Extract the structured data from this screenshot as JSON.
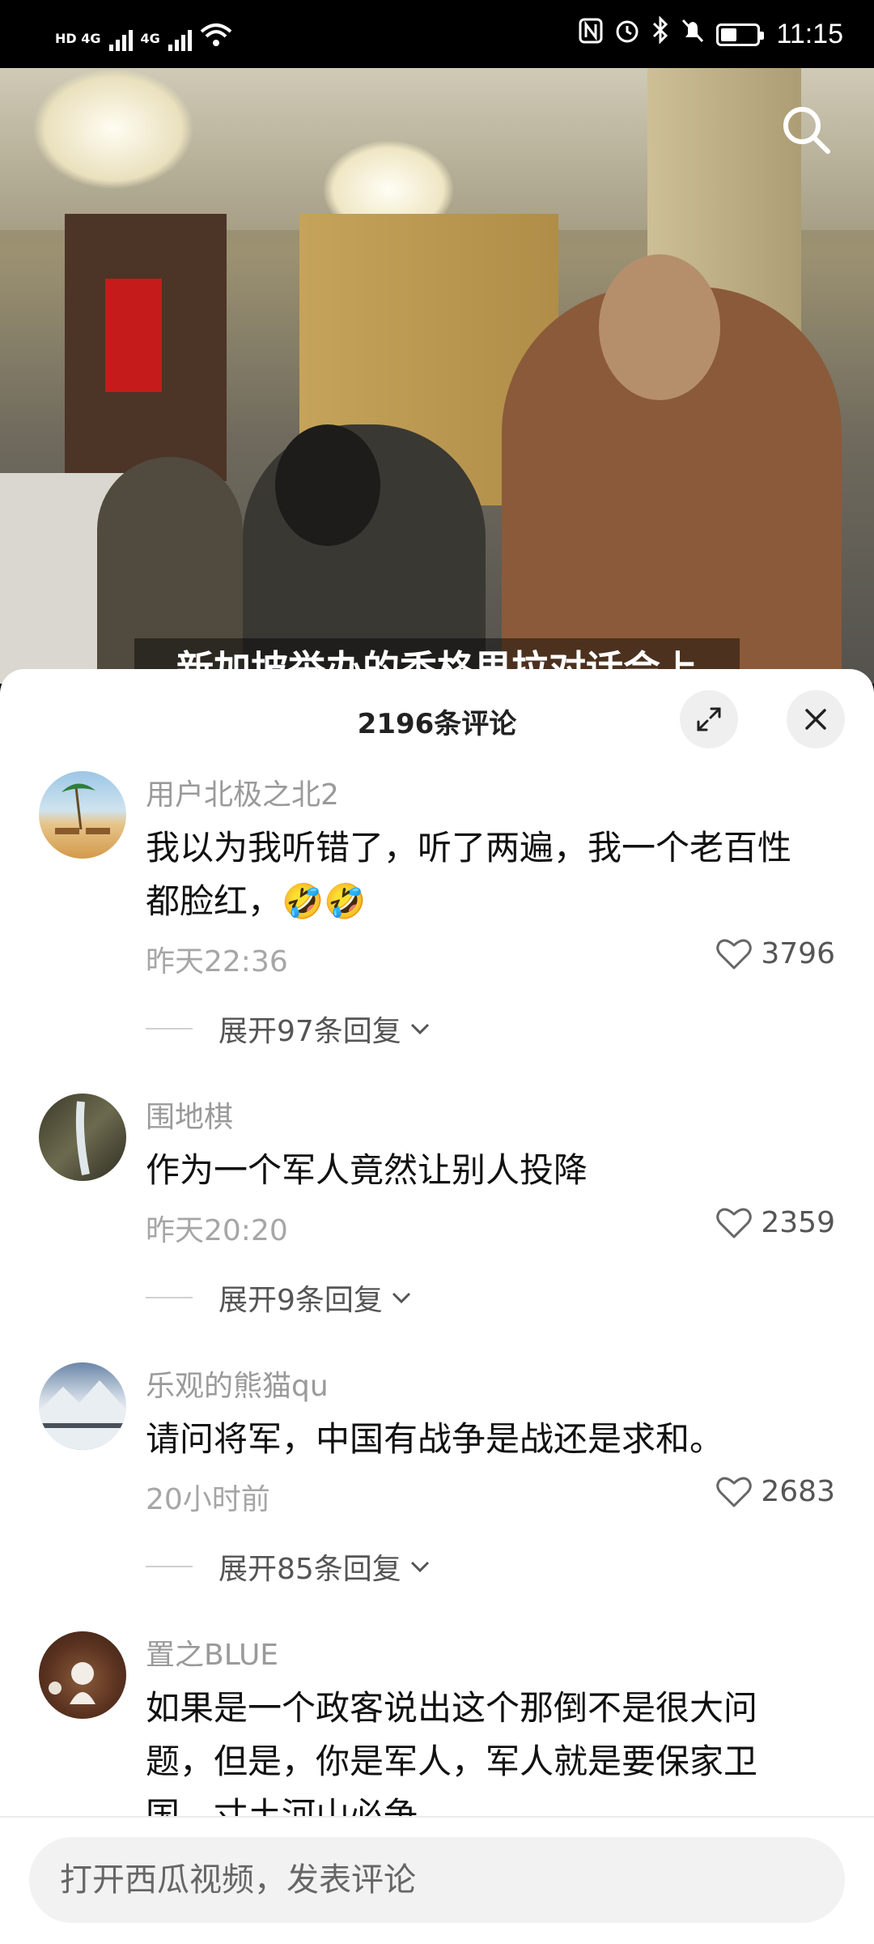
{
  "status_bar": {
    "network_left": "HD 4G",
    "network_right": "4G",
    "time": "11:15",
    "battery_level_percent": 45,
    "icons": [
      "hd-icon",
      "signal-icon",
      "wifi-icon",
      "nfc-icon",
      "alarm-icon",
      "bluetooth-icon",
      "mute-icon",
      "battery-icon"
    ]
  },
  "video": {
    "subtitle": "新加坡举办的香格里拉对话会上",
    "search_icon": "search-icon"
  },
  "comments_panel": {
    "title": "2196条评论",
    "expand_icon": "expand-icon",
    "close_icon": "close-icon",
    "comments": [
      {
        "user": "用户北极之北2",
        "text": "我以为我听错了，听了两遍，我一个老百性都脸红，🤣🤣",
        "time": "昨天22:36",
        "likes": "3796",
        "replies": "展开97条回复"
      },
      {
        "user": "围地棋",
        "text": "作为一个军人竟然让别人投降",
        "time": "昨天20:20",
        "likes": "2359",
        "replies": "展开9条回复"
      },
      {
        "user": "乐观的熊猫qu",
        "text": "请问将军，中国有战争是战还是求和。",
        "time": "20小时前",
        "likes": "2683",
        "replies": "展开85条回复"
      },
      {
        "user": "置之BLUE",
        "text": "如果是一个政客说出这个那倒不是很大问题，但是，你是军人，军人就是要保家卫国，寸土河山必争。"
      }
    ]
  },
  "bottom": {
    "input_placeholder": "打开西瓜视频，发表评论"
  },
  "colors": {
    "accent_gray": "#9a9a9a",
    "text_dark": "#111111",
    "sheet_bg": "#ffffff",
    "input_bg": "#f2f2f2"
  }
}
